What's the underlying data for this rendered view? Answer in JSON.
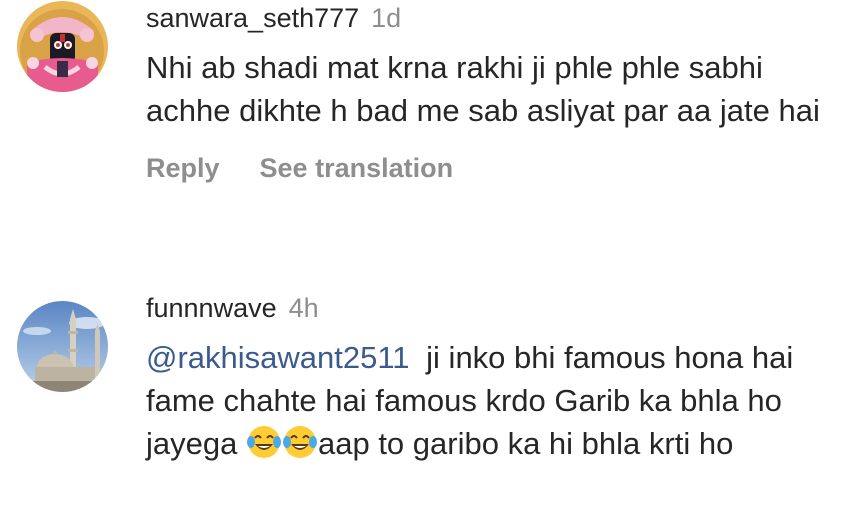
{
  "comments": [
    {
      "username": "sanwara_seth777",
      "time": "1d",
      "text": "Nhi ab shadi mat krna rakhi ji phle phle sabhi achhe dikhte h bad me sab asliyat par aa jate hai",
      "reply_label": "Reply",
      "translation_label": "See translation",
      "avatar_icon": "deity-avatar"
    },
    {
      "username": "funnnwave",
      "time": "4h",
      "mention": "@rakhisawant2511",
      "text_part1": "ji inko bhi famous hona hai fame chahte hai famous krdo Garib ka bhla ho jayega",
      "emojis": [
        "face-with-tears-of-joy",
        "face-with-tears-of-joy"
      ],
      "text_part2": "aap to garibo ka hi bhla krti ho",
      "avatar_icon": "monument-avatar"
    }
  ],
  "colors": {
    "text": "#262626",
    "secondary": "#8e8e8e",
    "mention": "#3b5b8f"
  }
}
